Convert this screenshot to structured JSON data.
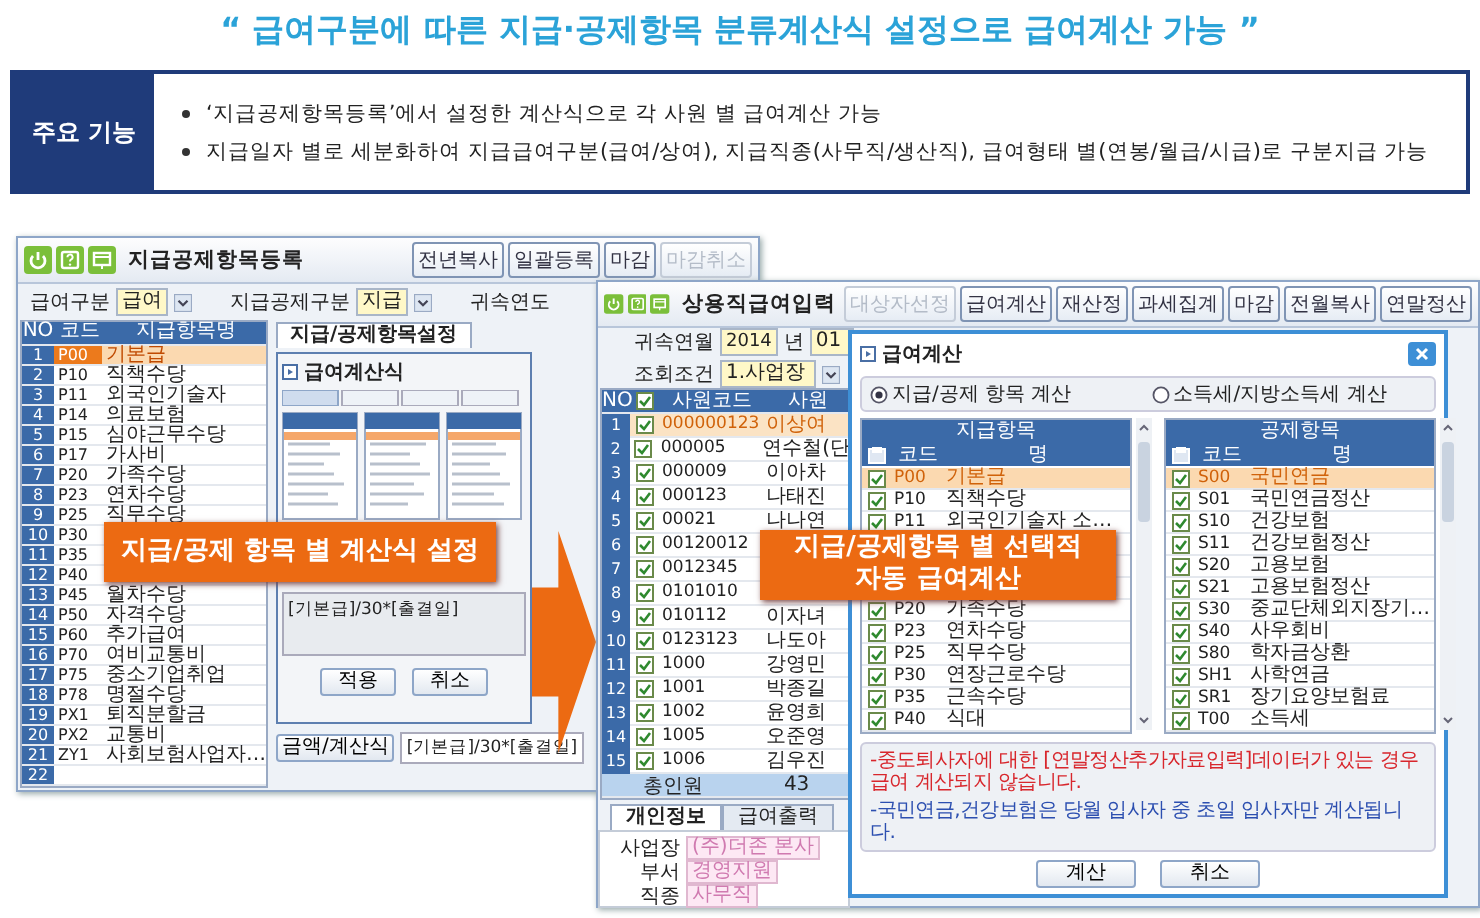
{
  "headline": "“ 급여구분에 따른 지급·공제항목 분류계산식 설정으로 급여계산 가능 ”",
  "feature_box": {
    "label": "주요 기능",
    "bullets": [
      "‘지급공제항목등록’에서 설정한 계산식으로 각 사원 별 급여계산 가능",
      "지급일자 별로 세분화하여 지급급여구분(급여/상여), 지급직종(사무직/생산직), 급여형태 별(연봉/월급/시급)로 구분지급 가능"
    ]
  },
  "left_window": {
    "title": "지급공제항목등록",
    "buttons": [
      {
        "label": "전년복사",
        "disabled": false
      },
      {
        "label": "일괄등록",
        "disabled": false
      },
      {
        "label": "마감",
        "disabled": false
      },
      {
        "label": "마감취소",
        "disabled": true
      }
    ],
    "filters": [
      {
        "label": "급여구분",
        "value": "급여"
      },
      {
        "label": "지급공제구분",
        "value": "지급"
      }
    ],
    "year_label": "귀속연도",
    "columns": [
      "NO",
      "코드",
      "지급항목명"
    ],
    "rows": [
      {
        "no": "1",
        "code": "P00",
        "name": "기본급",
        "selected": true
      },
      {
        "no": "2",
        "code": "P10",
        "name": "직책수당",
        "selected": false
      },
      {
        "no": "3",
        "code": "P11",
        "name": "외국인기술자",
        "selected": false
      },
      {
        "no": "4",
        "code": "P14",
        "name": "의료보험",
        "selected": false
      },
      {
        "no": "5",
        "code": "P15",
        "name": "심야근무수당",
        "selected": false
      },
      {
        "no": "6",
        "code": "P17",
        "name": "가사비",
        "selected": false
      },
      {
        "no": "7",
        "code": "P20",
        "name": "가족수당",
        "selected": false
      },
      {
        "no": "8",
        "code": "P23",
        "name": "연차수당",
        "selected": false
      },
      {
        "no": "9",
        "code": "P25",
        "name": "직무수당",
        "selected": false
      },
      {
        "no": "10",
        "code": "P30",
        "selected": false
      },
      {
        "no": "11",
        "code": "P35",
        "selected": false
      },
      {
        "no": "12",
        "code": "P40",
        "selected": false
      },
      {
        "no": "13",
        "code": "P45",
        "name": "월차수당",
        "selected": false
      },
      {
        "no": "14",
        "code": "P50",
        "name": "자격수당",
        "selected": false
      },
      {
        "no": "15",
        "code": "P60",
        "name": "추가급여",
        "selected": false
      },
      {
        "no": "16",
        "code": "P70",
        "name": "여비교통비",
        "selected": false
      },
      {
        "no": "17",
        "code": "P75",
        "name": "중소기업취업",
        "selected": false
      },
      {
        "no": "18",
        "code": "P78",
        "name": "명절수당",
        "selected": false
      },
      {
        "no": "19",
        "code": "PX1",
        "name": "퇴직분할금",
        "selected": false
      },
      {
        "no": "20",
        "code": "PX2",
        "name": "교통비",
        "selected": false
      },
      {
        "no": "21",
        "code": "ZY1",
        "name": "사회보험사업자…",
        "selected": false
      },
      {
        "no": "22",
        "selected": false
      }
    ],
    "tabs": [
      {
        "label": "지급/공제항목설정",
        "selected": true
      }
    ],
    "formula_dialog": {
      "title": "급여계산식",
      "formula": "[기본급]/30*[출결일]",
      "buttons": [
        "적용",
        "취소"
      ]
    },
    "formula_button": "금액/계산식",
    "formula_value": "[기본급]/30*[출결일]",
    "callout": "지급/공제 항목 별 계산식 설정"
  },
  "right_window": {
    "title": "상용직급여입력",
    "buttons": [
      {
        "label": "대상자선정",
        "disabled": true
      },
      {
        "label": "급여계산",
        "disabled": false
      },
      {
        "label": "재산정",
        "disabled": false
      },
      {
        "label": "과세집계",
        "disabled": false
      },
      {
        "label": "마감",
        "disabled": false
      },
      {
        "label": "전월복사",
        "disabled": false
      },
      {
        "label": "연말정산",
        "disabled": false
      }
    ],
    "period": {
      "label": "귀속연월",
      "year": "2014",
      "unit": "년",
      "month": "01"
    },
    "query": {
      "label": "조회조건",
      "value": "1.사업장"
    },
    "columns": [
      "NO",
      "사원코드",
      "사원"
    ],
    "rows": [
      {
        "no": "1",
        "checked": true,
        "code": "000000123",
        "name": "이상여",
        "selected": true
      },
      {
        "no": "2",
        "checked": true,
        "code": "000005",
        "name": "연수철(단",
        "selected": false
      },
      {
        "no": "3",
        "checked": true,
        "code": "000009",
        "name": "이아차",
        "selected": false
      },
      {
        "no": "4",
        "checked": true,
        "code": "000123",
        "name": "나태진",
        "selected": false
      },
      {
        "no": "5",
        "checked": true,
        "code": "00021",
        "name": "나나연",
        "selected": false
      },
      {
        "no": "6",
        "checked": true,
        "code": "00120012",
        "selected": false
      },
      {
        "no": "7",
        "checked": true,
        "code": "0012345",
        "selected": false
      },
      {
        "no": "8",
        "checked": true,
        "code": "0101010",
        "selected": false
      },
      {
        "no": "9",
        "checked": true,
        "code": "010112",
        "name": "이자녀",
        "selected": false
      },
      {
        "no": "10",
        "checked": true,
        "code": "0123123",
        "name": "나도아",
        "selected": false
      },
      {
        "no": "11",
        "checked": true,
        "code": "1000",
        "name": "강영민",
        "selected": false
      },
      {
        "no": "12",
        "checked": true,
        "code": "1001",
        "name": "박종길",
        "selected": false
      },
      {
        "no": "13",
        "checked": true,
        "code": "1002",
        "name": "윤영희",
        "selected": false
      },
      {
        "no": "14",
        "checked": true,
        "code": "1005",
        "name": "오준영",
        "selected": false
      },
      {
        "no": "15",
        "checked": true,
        "code": "1006",
        "name": "김우진",
        "selected": false
      }
    ],
    "total": {
      "label": "총인원",
      "value": "43"
    },
    "tabs": [
      {
        "label": "개인정보",
        "selected": true
      },
      {
        "label": "급여출력",
        "selected": false
      }
    ],
    "fields": [
      {
        "label": "사업장",
        "value": "(주)더존 본사"
      },
      {
        "label": "부서",
        "value": "경영지원"
      },
      {
        "label": "직종",
        "value": "사무직"
      }
    ],
    "callout": "지급/공제항목 별 선택적\n자동 급여계산"
  },
  "calc_dialog": {
    "title": "급여계산",
    "options": [
      {
        "label": "지급/공제 항목 계산",
        "selected": true
      },
      {
        "label": "소득세/지방소득세 계산",
        "selected": false
      }
    ],
    "tables": [
      {
        "title": "지급항목",
        "columns": [
          "코드",
          "명"
        ],
        "rows": [
          {
            "kind": "item",
            "checked": true,
            "code": "P00",
            "name": "기본급",
            "selected": true
          },
          {
            "kind": "item",
            "checked": true,
            "code": "P10",
            "name": "직책수당",
            "selected": false
          },
          {
            "kind": "item",
            "checked": true,
            "code": "P11",
            "name": "외국인기술자 소…",
            "selected": false
          },
          {
            "kind": "covered"
          },
          {
            "kind": "covered"
          },
          {
            "kind": "covered"
          },
          {
            "kind": "item",
            "checked": true,
            "code": "P20",
            "name": "가족수당",
            "selected": false
          },
          {
            "kind": "item",
            "checked": true,
            "code": "P23",
            "name": "연차수당",
            "selected": false
          },
          {
            "kind": "item",
            "checked": true,
            "code": "P25",
            "name": "직무수당",
            "selected": false
          },
          {
            "kind": "item",
            "checked": true,
            "code": "P30",
            "name": "연장근로수당",
            "selected": false
          },
          {
            "kind": "item",
            "checked": true,
            "code": "P35",
            "name": "근속수당",
            "selected": false
          },
          {
            "kind": "item",
            "checked": true,
            "code": "P40",
            "name": "식대",
            "selected": false
          }
        ]
      },
      {
        "title": "공제항목",
        "columns": [
          "코드",
          "명"
        ],
        "rows": [
          {
            "kind": "item",
            "checked": true,
            "code": "S00",
            "name": "국민연금",
            "selected": true
          },
          {
            "kind": "item",
            "checked": true,
            "code": "S01",
            "name": "국민연금정산",
            "selected": false
          },
          {
            "kind": "item",
            "checked": true,
            "code": "S10",
            "name": "건강보험",
            "selected": false
          },
          {
            "kind": "item",
            "checked": true,
            "code": "S11",
            "name": "건강보험정산",
            "selected": false
          },
          {
            "kind": "item",
            "checked": true,
            "code": "S20",
            "name": "고용보험",
            "selected": false
          },
          {
            "kind": "item",
            "checked": true,
            "code": "S21",
            "name": "고용보험정산",
            "selected": false
          },
          {
            "kind": "item",
            "checked": true,
            "code": "S30",
            "name": "중교단체외지장기…",
            "selected": false
          },
          {
            "kind": "item",
            "checked": true,
            "code": "S40",
            "name": "사우회비",
            "selected": false
          },
          {
            "kind": "item",
            "checked": true,
            "code": "S80",
            "name": "학자금상환",
            "selected": false
          },
          {
            "kind": "item",
            "checked": true,
            "code": "SH1",
            "name": "사학연금",
            "selected": false
          },
          {
            "kind": "item",
            "checked": true,
            "code": "SR1",
            "name": "장기요양보험료",
            "selected": false
          },
          {
            "kind": "item",
            "checked": true,
            "code": "T00",
            "name": "소득세",
            "selected": false
          }
        ]
      }
    ],
    "notes": [
      {
        "kind": "warning",
        "text": "-중도퇴사자에 대한 [연말정산추가자료입력]데이터가 있는 경우 급여 계산되지 않습니다."
      },
      {
        "kind": "info",
        "text": "-국민연금,건강보험은 당월 입사자 중 초일 입사자만 계산됩니다."
      }
    ],
    "buttons": [
      "계산",
      "취소"
    ]
  }
}
